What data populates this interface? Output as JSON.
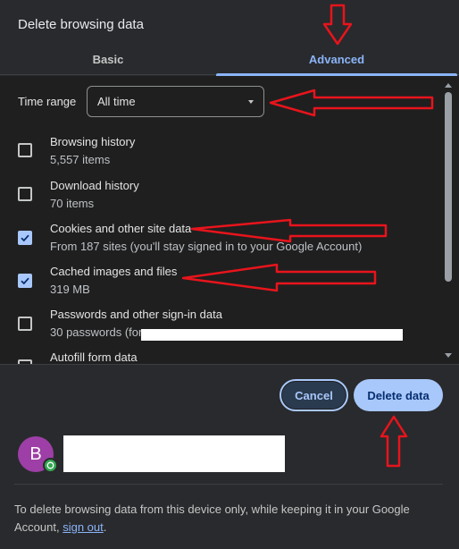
{
  "dialog": {
    "title": "Delete browsing data"
  },
  "tabs": [
    {
      "label": "Basic",
      "selected": false
    },
    {
      "label": "Advanced",
      "selected": true
    }
  ],
  "time_range": {
    "label": "Time range",
    "value": "All time"
  },
  "items": [
    {
      "label": "Browsing history",
      "detail": "5,557 items",
      "checked": false
    },
    {
      "label": "Download history",
      "detail": "70 items",
      "checked": false
    },
    {
      "label": "Cookies and other site data",
      "detail": "From 187 sites (you'll stay signed in to your Google Account)",
      "checked": true
    },
    {
      "label": "Cached images and files",
      "detail": "319 MB",
      "checked": true
    },
    {
      "label": "Passwords and other sign-in data",
      "detail": "30 passwords (for",
      "checked": false
    },
    {
      "label": "Autofill form data",
      "detail": "",
      "checked": false
    }
  ],
  "buttons": {
    "cancel": "Cancel",
    "delete": "Delete data"
  },
  "account": {
    "avatar_letter": "B"
  },
  "footer": {
    "text": "To delete browsing data from this device only, while keeping it in your Google Account,",
    "link": "sign out",
    "end": "."
  },
  "colors": {
    "accent": "#8ab4f8",
    "primary_button": "#a8c7fa",
    "annotation": "#e8141c"
  }
}
